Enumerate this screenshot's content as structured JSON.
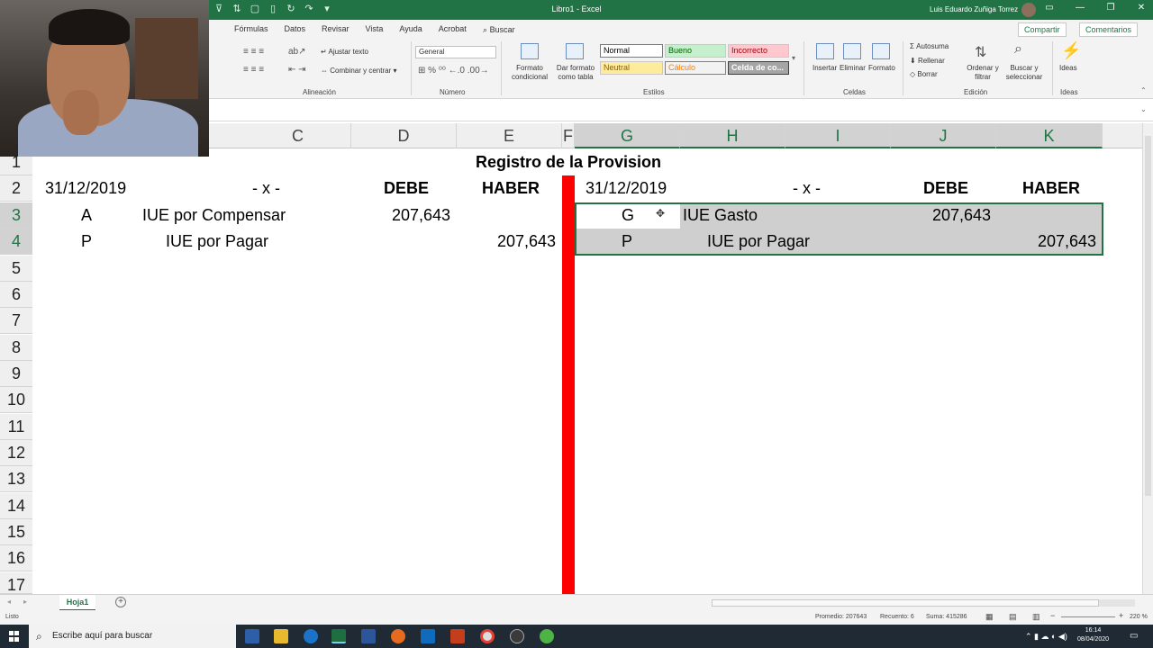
{
  "window": {
    "title": "Libro1 - Excel",
    "user": "Luis Eduardo Zuñiga Torrez"
  },
  "ribbon": {
    "tabs": [
      "Fórmulas",
      "Datos",
      "Revisar",
      "Vista",
      "Ayuda",
      "Acrobat"
    ],
    "search": "Buscar",
    "share": "Compartir",
    "comments": "Comentarios",
    "alignment": {
      "wrap_text": "Ajustar texto",
      "merge": "Combinar y centrar",
      "group_label": "Alineación"
    },
    "number": {
      "format": "General",
      "group_label": "Número"
    },
    "styles": {
      "cond_format": "Formato condicional",
      "table_format": "Dar formato como tabla",
      "normal": "Normal",
      "bueno": "Bueno",
      "incorrecto": "Incorrecto",
      "neutral": "Neutral",
      "calculo": "Cálculo",
      "celda": "Celda de co...",
      "group_label": "Estilos"
    },
    "cells": {
      "insert": "Insertar",
      "delete": "Eliminar",
      "format": "Formato",
      "group_label": "Celdas"
    },
    "editing": {
      "autosum": "Autosuma",
      "fill": "Rellenar",
      "clear": "Borrar",
      "sort": "Ordenar y filtrar",
      "find": "Buscar y seleccionar",
      "group_label": "Edición"
    },
    "ideas": {
      "label": "Ideas",
      "group_label": "Ideas"
    }
  },
  "columns": [
    "C",
    "D",
    "E",
    "F",
    "G",
    "H",
    "I",
    "J",
    "K"
  ],
  "rows": [
    "1",
    "2",
    "3",
    "4",
    "5",
    "6",
    "7",
    "8",
    "9",
    "10",
    "11",
    "12",
    "13",
    "14",
    "15",
    "16",
    "17"
  ],
  "sheet": {
    "title": "Registro de la Provision",
    "left": {
      "date": "31/12/2019",
      "x": "- x -",
      "debe": "DEBE",
      "haber": "HABER",
      "r3_code": "A",
      "r3_account": "IUE por Compensar",
      "r3_debe": "207,643",
      "r4_code": "P",
      "r4_account": "IUE por Pagar",
      "r4_haber": "207,643"
    },
    "right": {
      "date": "31/12/2019",
      "x": "- x -",
      "debe": "DEBE",
      "haber": "HABER",
      "r3_code": "G",
      "r3_account": "IUE Gasto",
      "r3_debe": "207,643",
      "r4_code": "P",
      "r4_account": "IUE por Pagar",
      "r4_haber": "207,643"
    }
  },
  "sheet_tab": "Hoja1",
  "status": {
    "ready": "Listo",
    "average": "Promedio: 207643",
    "count": "Recuento: 6",
    "sum": "Suma: 415286",
    "zoom": "220 %"
  },
  "taskbar": {
    "search": "Escribe aquí para buscar",
    "time": "16:14",
    "date": "08/04/2020"
  }
}
